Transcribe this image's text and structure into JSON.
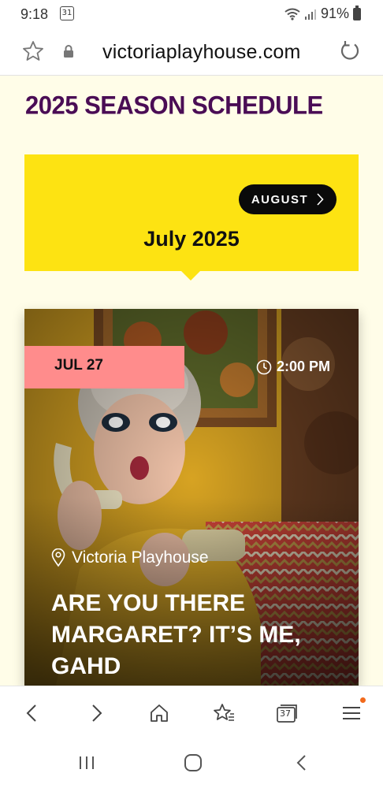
{
  "status_bar": {
    "time": "9:18",
    "calendar_day": "31",
    "battery": "91%"
  },
  "browser": {
    "url": "victoriaplayhouse.com",
    "tabs_count": "37"
  },
  "page": {
    "season_title": "2025 SEASON SCHEDULE",
    "month_nav": {
      "next_label": "AUGUST",
      "current_month": "July 2025"
    },
    "event": {
      "date": "JUL 27",
      "time": "2:00 PM",
      "venue": "Victoria Playhouse",
      "title": "ARE YOU THERE MARGARET? IT’S ME, GAHD"
    }
  },
  "colors": {
    "title_purple": "#4a0d55",
    "yellow": "#fde312",
    "badge_pink": "#ff8c8c",
    "page_bg": "#fffde8"
  }
}
